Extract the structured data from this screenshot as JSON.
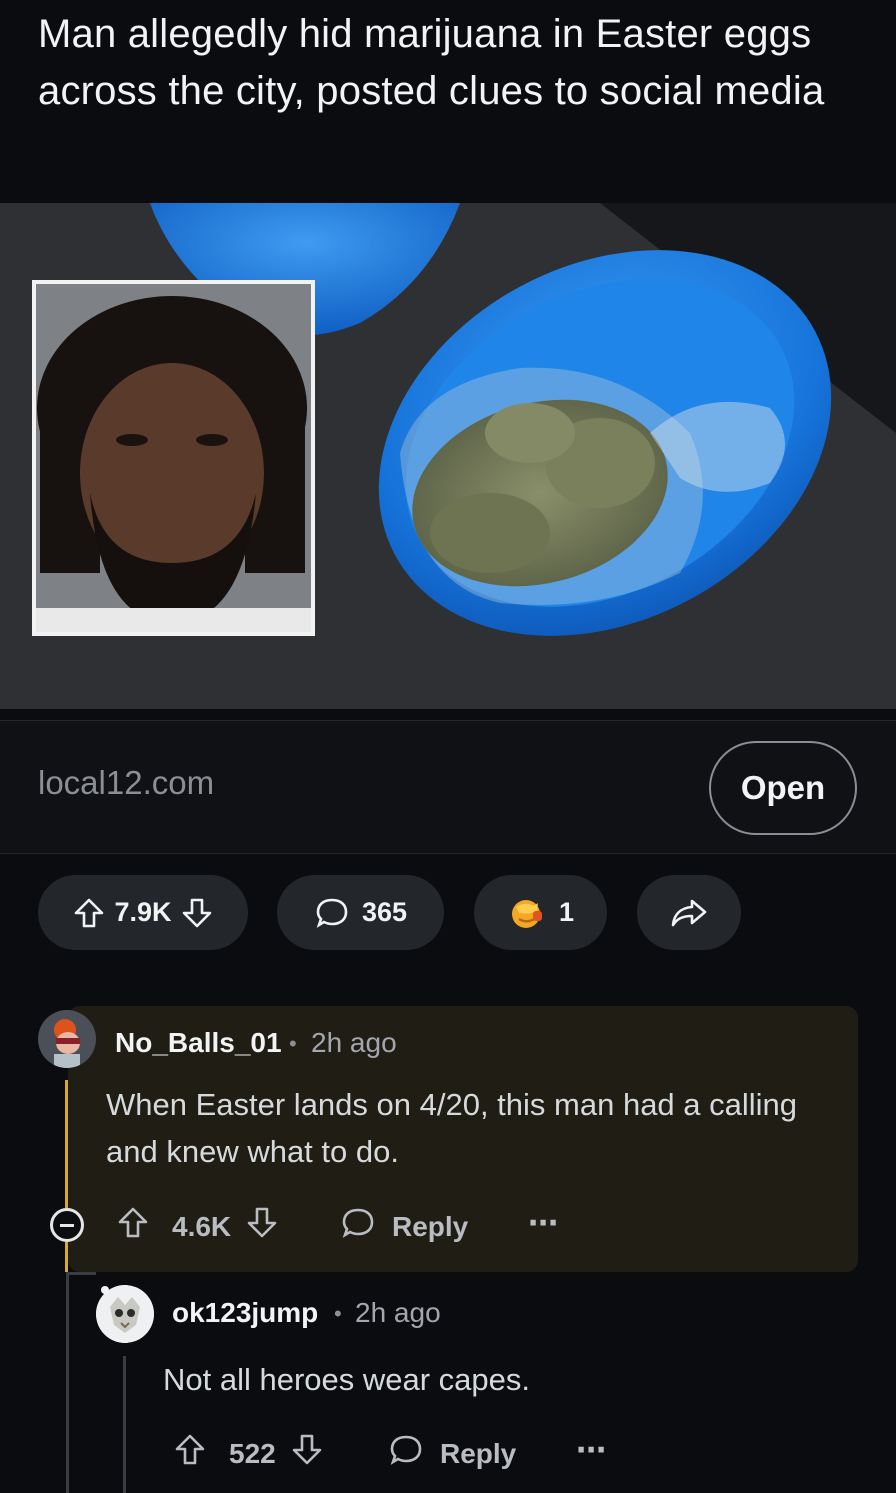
{
  "post": {
    "title": "Man allegedly hid marijuana in Easter eggs across the city, posted clues to social media",
    "link_domain": "local12.com",
    "open_label": "Open"
  },
  "actions": {
    "score": "7.9K",
    "comments": "365",
    "awards": "1"
  },
  "comments": [
    {
      "username": "No_Balls_01",
      "age": "2h ago",
      "text": "When Easter lands on 4/20, this man had a calling and knew what to do.",
      "score": "4.6K",
      "reply_label": "Reply"
    },
    {
      "username": "ok123jump",
      "age": "2h ago",
      "text": "Not all heroes wear capes.",
      "score": "522",
      "reply_label": "Reply"
    }
  ],
  "colors": {
    "background": "#0b0c0f",
    "highlight_comment_bg": "#1f1d14",
    "thread_accent": "#d9a92a",
    "egg_blue": "#1a7de0"
  }
}
